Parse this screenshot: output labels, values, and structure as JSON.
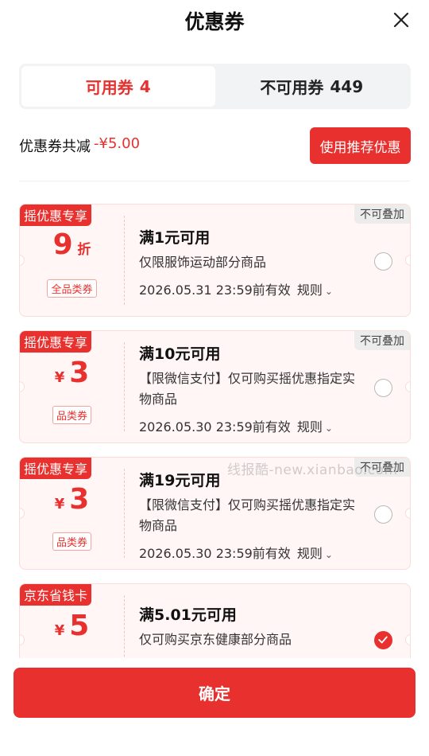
{
  "header": {
    "title": "优惠券",
    "close_icon": "close-icon"
  },
  "tabs": [
    {
      "label": "可用券",
      "count": "4",
      "active": true
    },
    {
      "label": "不可用券",
      "count": "449",
      "active": false
    }
  ],
  "summary": {
    "label": "优惠券共减",
    "amount": "-¥5.00",
    "recommend_button": "使用推荐优惠"
  },
  "coupons": [
    {
      "tag": "摇优惠专享",
      "no_stack": "不可叠加",
      "value": "9",
      "unit": "折",
      "currency": "",
      "type": "全品类券",
      "condition": "满1元可用",
      "desc": "仅限服饰运动部分商品",
      "expiry": "2026.05.31 23:59前有效",
      "rule": "规则",
      "selected": false
    },
    {
      "tag": "摇优惠专享",
      "no_stack": "不可叠加",
      "value": "3",
      "unit": "",
      "currency": "¥",
      "type": "品类券",
      "condition": "满10元可用",
      "desc": "【限微信支付】仅可购买摇优惠指定实物商品",
      "expiry": "2026.05.30 23:59前有效",
      "rule": "规则",
      "selected": false
    },
    {
      "tag": "摇优惠专享",
      "no_stack": "不可叠加",
      "value": "3",
      "unit": "",
      "currency": "¥",
      "type": "品类券",
      "condition": "满19元可用",
      "desc": "【限微信支付】仅可购买摇优惠指定实物商品",
      "expiry": "2026.05.30 23:59前有效",
      "rule": "规则",
      "selected": false
    },
    {
      "tag": "京东省钱卡",
      "no_stack": "",
      "value": "5",
      "unit": "",
      "currency": "¥",
      "type": "",
      "condition": "满5.01元可用",
      "desc": "仅可购买京东健康部分商品",
      "expiry": "",
      "rule": "",
      "selected": true
    }
  ],
  "watermark": "线报酷-new.xianbao.com",
  "footer": {
    "confirm_label": "确定"
  },
  "colors": {
    "accent": "#e8302e",
    "card_bg": "#fff6f5"
  }
}
